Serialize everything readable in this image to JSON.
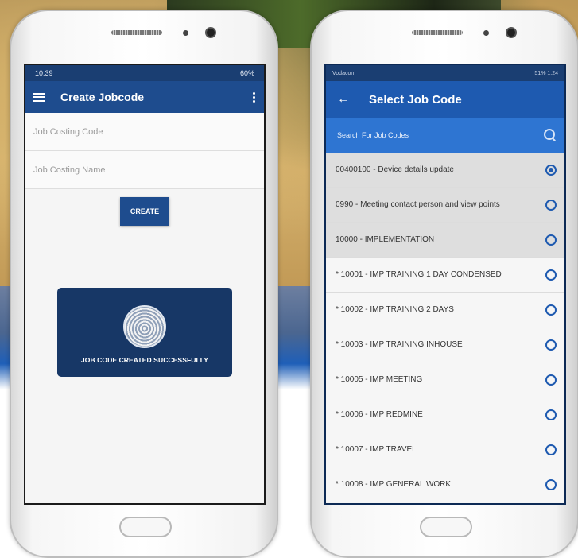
{
  "left_phone": {
    "status_time": "10:39",
    "status_right": "60%",
    "title": "Create Jobcode",
    "code_placeholder": "Job Costing Code",
    "name_placeholder": "Job Costing Name",
    "create_label": "CREATE",
    "toast_text": "JOB CODE CREATED SUCCESSFULLY"
  },
  "right_phone": {
    "status_left": "Vodacom",
    "status_right": "51% 1:24",
    "title": "Select Job Code",
    "search_placeholder": "Search For Job Codes",
    "items": [
      {
        "label": "00400100 - Device details update",
        "selected": true,
        "highlighted": true
      },
      {
        "label": "0990 - Meeting contact person and view points",
        "selected": false,
        "highlighted": true
      },
      {
        "label": "10000 - IMPLEMENTATION",
        "selected": false,
        "highlighted": true
      },
      {
        "label": "* 10001 - IMP TRAINING 1 DAY CONDENSED",
        "selected": false,
        "highlighted": false
      },
      {
        "label": "* 10002 - IMP TRAINING 2 DAYS",
        "selected": false,
        "highlighted": false
      },
      {
        "label": "* 10003 - IMP TRAINING INHOUSE",
        "selected": false,
        "highlighted": false
      },
      {
        "label": "* 10005 - IMP MEETING",
        "selected": false,
        "highlighted": false
      },
      {
        "label": "* 10006 - IMP REDMINE",
        "selected": false,
        "highlighted": false
      },
      {
        "label": "* 10007 - IMP TRAVEL",
        "selected": false,
        "highlighted": false
      },
      {
        "label": "* 10008 - IMP GENERAL WORK",
        "selected": false,
        "highlighted": false
      }
    ]
  },
  "colors": {
    "appbar_left": "#1e4c8e",
    "appbar_right": "#1e5ab0",
    "search_bar": "#2e75d2",
    "toast_bg": "#173766"
  }
}
